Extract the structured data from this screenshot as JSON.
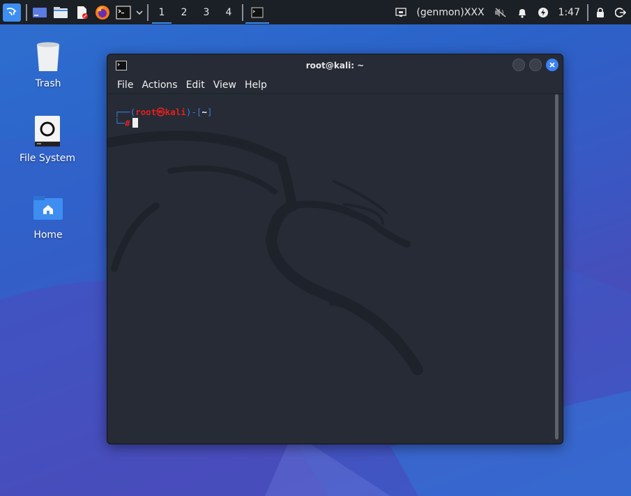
{
  "panel": {
    "workspaces": [
      "1",
      "2",
      "3",
      "4"
    ],
    "active_workspace": "1",
    "genmon_text": "(genmon)XXX",
    "clock": "1:47"
  },
  "desktop": {
    "icons": [
      {
        "label": "Trash",
        "icon": "trash-icon"
      },
      {
        "label": "File System",
        "icon": "drive-icon"
      },
      {
        "label": "Home",
        "icon": "home-folder-icon"
      }
    ]
  },
  "terminal": {
    "title": "root@kali: ~",
    "menu": [
      "File",
      "Actions",
      "Edit",
      "View",
      "Help"
    ],
    "prompt": {
      "line1_open": "┌──(",
      "user": "root",
      "at": "㉿",
      "host": "kali",
      "line1_mid": ")-[",
      "dir": "~",
      "line1_close": "]",
      "line2_prefix": "└─",
      "symbol": "#"
    }
  },
  "colors": {
    "accent": "#3d8ef0",
    "panel_bg": "#1b1f26",
    "terminal_bg": "#262b35",
    "prompt_red": "#e0211f",
    "prompt_blue": "#3a7fe6"
  }
}
